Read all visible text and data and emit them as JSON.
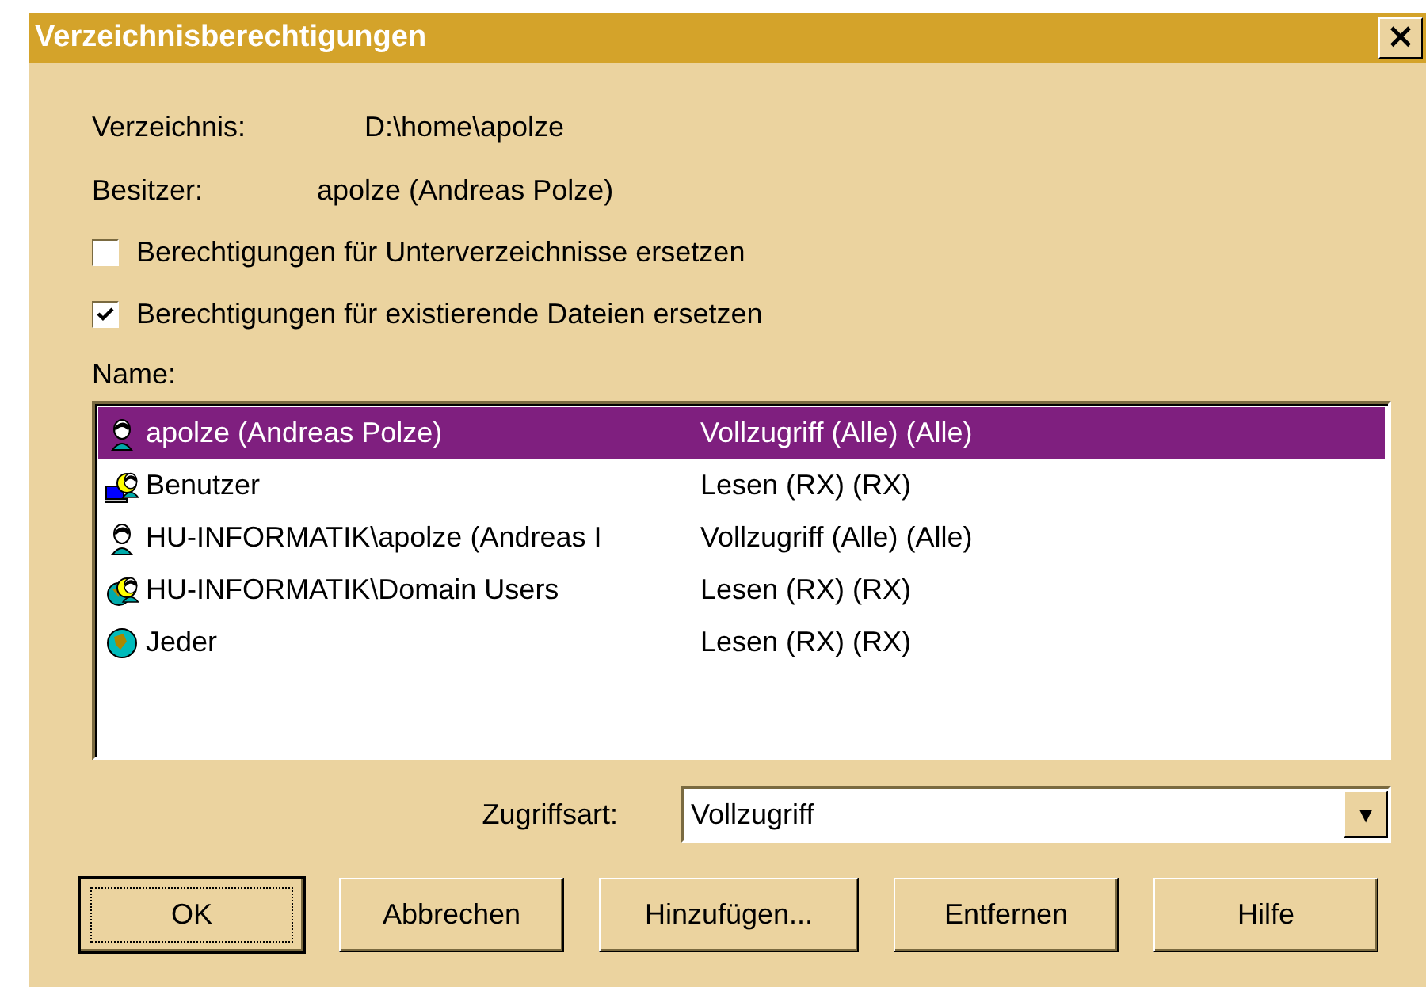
{
  "window": {
    "title": "Verzeichnisberechtigungen",
    "close": "×"
  },
  "directory": {
    "label": "Verzeichnis:",
    "value": "D:\\home\\apolze"
  },
  "owner": {
    "label": "Besitzer:",
    "value": "apolze (Andreas Polze)"
  },
  "options": [
    {
      "label": "Berechtigungen für Unterverzeichnisse ersetzen",
      "checked": false
    },
    {
      "label": "Berechtigungen für existierende Dateien ersetzen",
      "checked": true
    }
  ],
  "list": {
    "label": "Name:",
    "rows": [
      {
        "kind": "user",
        "name": "apolze (Andreas Polze)",
        "access": "Vollzugriff (Alle) (Alle)",
        "selected": true
      },
      {
        "kind": "group",
        "name": "Benutzer",
        "access": "Lesen (RX) (RX)",
        "selected": false
      },
      {
        "kind": "user",
        "name": "HU-INFORMATIK\\apolze (Andreas I",
        "access": "Vollzugriff (Alle) (Alle)",
        "selected": false
      },
      {
        "kind": "domain-group",
        "name": "HU-INFORMATIK\\Domain Users",
        "access": "Lesen (RX) (RX)",
        "selected": false
      },
      {
        "kind": "everyone",
        "name": "Jeder",
        "access": "Lesen (RX) (RX)",
        "selected": false
      }
    ]
  },
  "access_type": {
    "label": "Zugriffsart:",
    "value": "Vollzugriff",
    "arrow": "▼"
  },
  "buttons": [
    {
      "label": "OK",
      "default": true
    },
    {
      "label": "Abbrechen",
      "default": false
    },
    {
      "label": "Hinzufügen...",
      "default": false
    },
    {
      "label": "Entfernen",
      "default": false
    },
    {
      "label": "Hilfe",
      "default": false
    }
  ]
}
